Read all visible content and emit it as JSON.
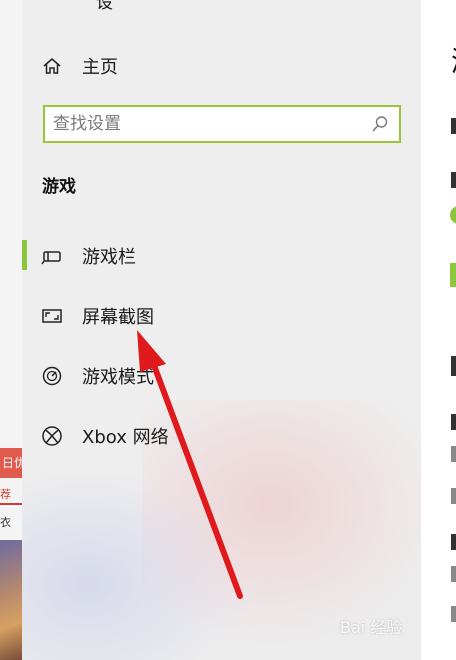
{
  "background_app": {
    "red_bar_text": "日优",
    "tag_text": "荐",
    "label_text": "衣"
  },
  "nav": {
    "top_cut_text": "设",
    "home_label": "主页",
    "search": {
      "placeholder": "查找设置",
      "value": ""
    },
    "section_heading": "游戏",
    "items": [
      {
        "label": "游戏栏",
        "icon": "game-bar-icon",
        "selected": true
      },
      {
        "label": "屏幕截图",
        "icon": "screenshot-icon",
        "selected": false
      },
      {
        "label": "游戏模式",
        "icon": "game-mode-icon",
        "selected": false
      },
      {
        "label": "Xbox 网络",
        "icon": "xbox-icon",
        "selected": false
      }
    ]
  },
  "content": {
    "title_fragment": "游"
  },
  "colors": {
    "accent": "#8cc63f",
    "search_border": "#9bc53d",
    "arrow": "#e0191c"
  },
  "watermark": "Bai 经验"
}
